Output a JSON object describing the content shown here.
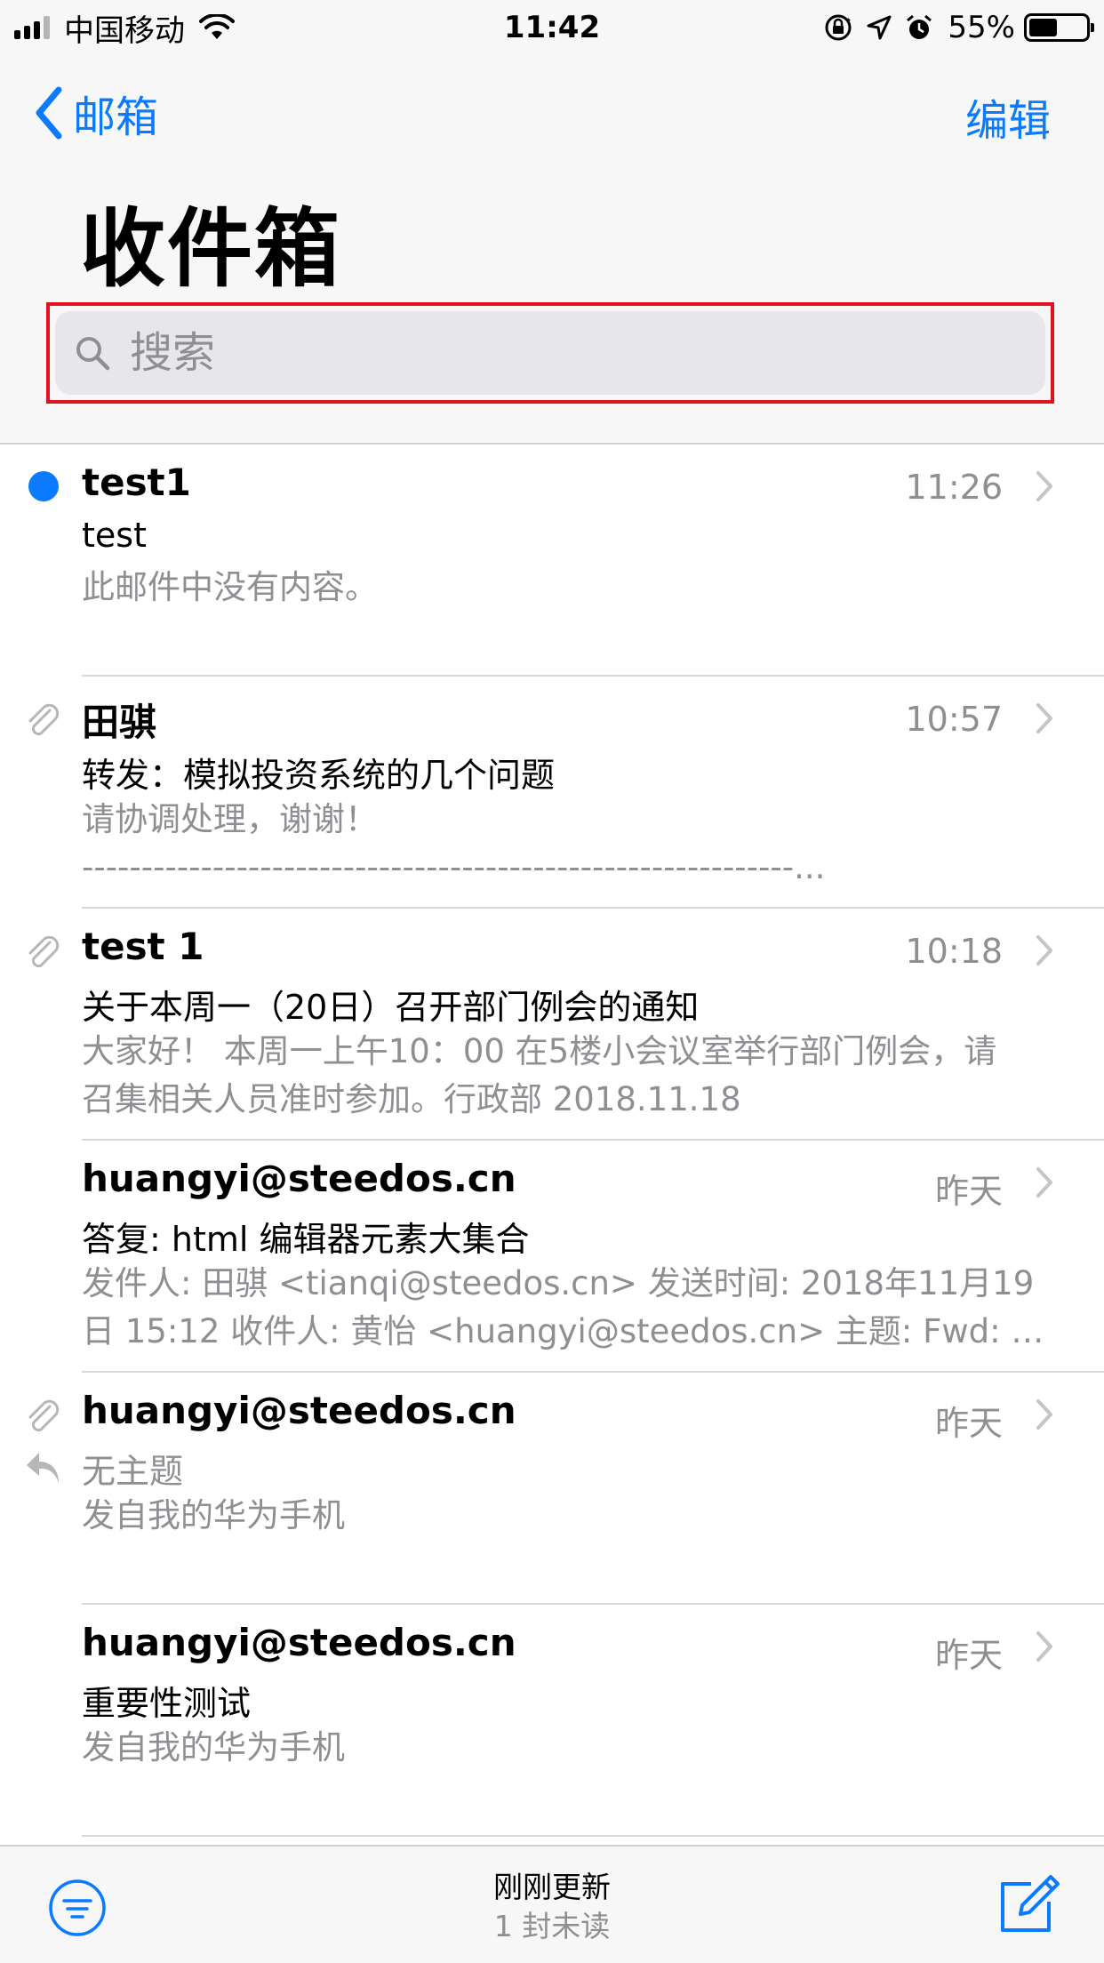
{
  "status_bar": {
    "carrier": "中国移动",
    "time": "11:42",
    "battery_percent": "55%",
    "battery_level": 0.55,
    "icons": [
      "signal-icon",
      "wifi-icon",
      "orientation-lock-icon",
      "location-icon",
      "alarm-icon",
      "battery-icon"
    ]
  },
  "nav": {
    "back_label": "邮箱",
    "edit_label": "编辑",
    "title": "收件箱"
  },
  "search": {
    "placeholder": "搜索"
  },
  "colors": {
    "accent": "#0a7aff",
    "highlight_border": "#e0121f",
    "secondary_text": "#8e8e93"
  },
  "mails": [
    {
      "sender": "test1",
      "time": "11:26",
      "subject": "test",
      "preview": [
        "此邮件中没有内容。"
      ],
      "unread": true,
      "attachment": false,
      "replied": false
    },
    {
      "sender": "田骐",
      "time": "10:57",
      "subject": "转发：模拟投资系统的几个问题",
      "preview": [
        "请协调处理，谢谢！",
        "------------------------------------------------------------..."
      ],
      "unread": false,
      "attachment": true,
      "replied": false
    },
    {
      "sender": "test 1",
      "time": "10:18",
      "subject": "关于本周一（20日）召开部门例会的通知",
      "preview": [
        "大家好！ 本周一上午10：00 在5楼小会议室举行部门例会，请",
        "召集相关人员准时参加。行政部   2018.11.18"
      ],
      "unread": false,
      "attachment": true,
      "replied": false
    },
    {
      "sender": "huangyi@steedos.cn",
      "time": "昨天",
      "subject": "答复: html  编辑器元素大集合",
      "preview": [
        "发件人: 田骐 <tianqi@steedos.cn> 发送时间: 2018年11月19",
        "日 15:12 收件人: 黄怡 <huangyi@steedos.cn> 主题: Fwd: h..."
      ],
      "unread": false,
      "attachment": false,
      "replied": false
    },
    {
      "sender": "huangyi@steedos.cn",
      "time": "昨天",
      "subject": "无主题",
      "preview": [
        "发自我的华为手机"
      ],
      "unread": false,
      "attachment": true,
      "replied": true
    },
    {
      "sender": "huangyi@steedos.cn",
      "time": "昨天",
      "subject": "重要性测试",
      "preview": [
        "发自我的华为手机"
      ],
      "unread": false,
      "attachment": false,
      "replied": false
    }
  ],
  "toolbar": {
    "status_main": "刚刚更新",
    "status_sub": "1 封未读",
    "filter_icon": "filter-icon",
    "compose_icon": "compose-icon"
  }
}
